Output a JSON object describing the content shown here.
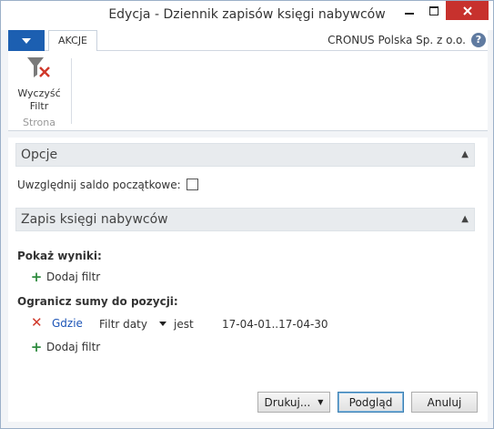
{
  "window": {
    "title": "Edycja - Dziennik zapisów księgi nabywców",
    "close_color": "#c7312d"
  },
  "ribbon": {
    "tab_label": "AKCJE",
    "company": "CRONUS Polska Sp. z o.o.",
    "help_glyph": "?",
    "clear_filter_label_line1": "Wyczyść",
    "clear_filter_label_line2": "Filtr",
    "group_label": "Strona",
    "accent": "#1c5fb1"
  },
  "options": {
    "header": "Opcje",
    "include_opening_balance_label": "Uwzględnij saldo początkowe:",
    "include_opening_balance_checked": false
  },
  "customer_ledger": {
    "header": "Zapis księgi nabywców",
    "show_results_label": "Pokaż wyniki:",
    "add_filter_label": "Dodaj filtr",
    "limit_totals_label": "Ogranicz sumy do pozycji:",
    "filter_row": {
      "where_label": "Gdzie",
      "field": "Filtr daty",
      "operator": "jest",
      "value": "17-04-01..17-04-30"
    },
    "add_filter_label_2": "Dodaj filtr"
  },
  "footer": {
    "print_label": "Drukuj...",
    "preview_label": "Podgląd",
    "cancel_label": "Anuluj"
  }
}
